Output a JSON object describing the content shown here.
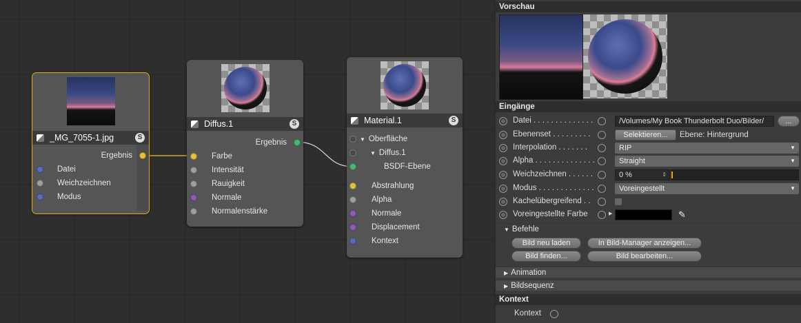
{
  "nodes": {
    "image": {
      "title": "_MG_7055-1.jpg",
      "badge": "S",
      "output": "Ergebnis",
      "inputs": [
        "Datei",
        "Weichzeichnen",
        "Modus"
      ]
    },
    "diffus": {
      "title": "Diffus.1",
      "badge": "S",
      "output": "Ergebnis",
      "inputs": [
        "Farbe",
        "Intensität",
        "Rauigkeit",
        "Normale",
        "Normalenstärke"
      ]
    },
    "material": {
      "title": "Material.1",
      "badge": "S",
      "tree": {
        "surface": "Oberfläche",
        "diffus": "Diffus.1",
        "bsdf": "BSDF-Ebene"
      },
      "inputs": [
        "Abstrahlung",
        "Alpha",
        "Normale",
        "Displacement",
        "Kontext"
      ]
    }
  },
  "panel": {
    "preview_title": "Vorschau",
    "inputs_title": "Eingänge",
    "rows": {
      "datei": {
        "label": "Datei . . . . . . . . . . . . . .",
        "value": "/Volumes/My Book Thunderbolt Duo/Bilder/",
        "more": "..."
      },
      "ebenenset": {
        "label": "Ebenenset . . . . . . . . .",
        "button": "Selektieren...",
        "info": "Ebene: Hintergrund"
      },
      "interpolation": {
        "label": "Interpolation . . . . . . .",
        "value": "RIP"
      },
      "alpha": {
        "label": "Alpha . . . . . . . . . . . . . .",
        "value": "Straight"
      },
      "weichzeichnen": {
        "label": "Weichzeichnen . . . . . .",
        "value": "0 %"
      },
      "modus": {
        "label": "Modus . . . . . . . . . . . . .",
        "value": "Voreingestellt"
      },
      "kachel": {
        "label": "Kachelübergreifend . ."
      },
      "farbe": {
        "label": "Voreingestellte Farbe",
        "color": "#000000"
      }
    },
    "befehle_title": "Befehle",
    "commands": {
      "reload": "Bild neu laden",
      "show_manager": "In Bild-Manager anzeigen...",
      "find": "Bild finden...",
      "edit": "Bild bearbeiten..."
    },
    "animation_title": "Animation",
    "sequence_title": "Bildsequenz",
    "context_title": "Kontext",
    "context_label": "Kontext"
  },
  "colors": {
    "selection": "#e8a921",
    "port_yellow": "#e3c23c",
    "port_green": "#49b86f"
  }
}
